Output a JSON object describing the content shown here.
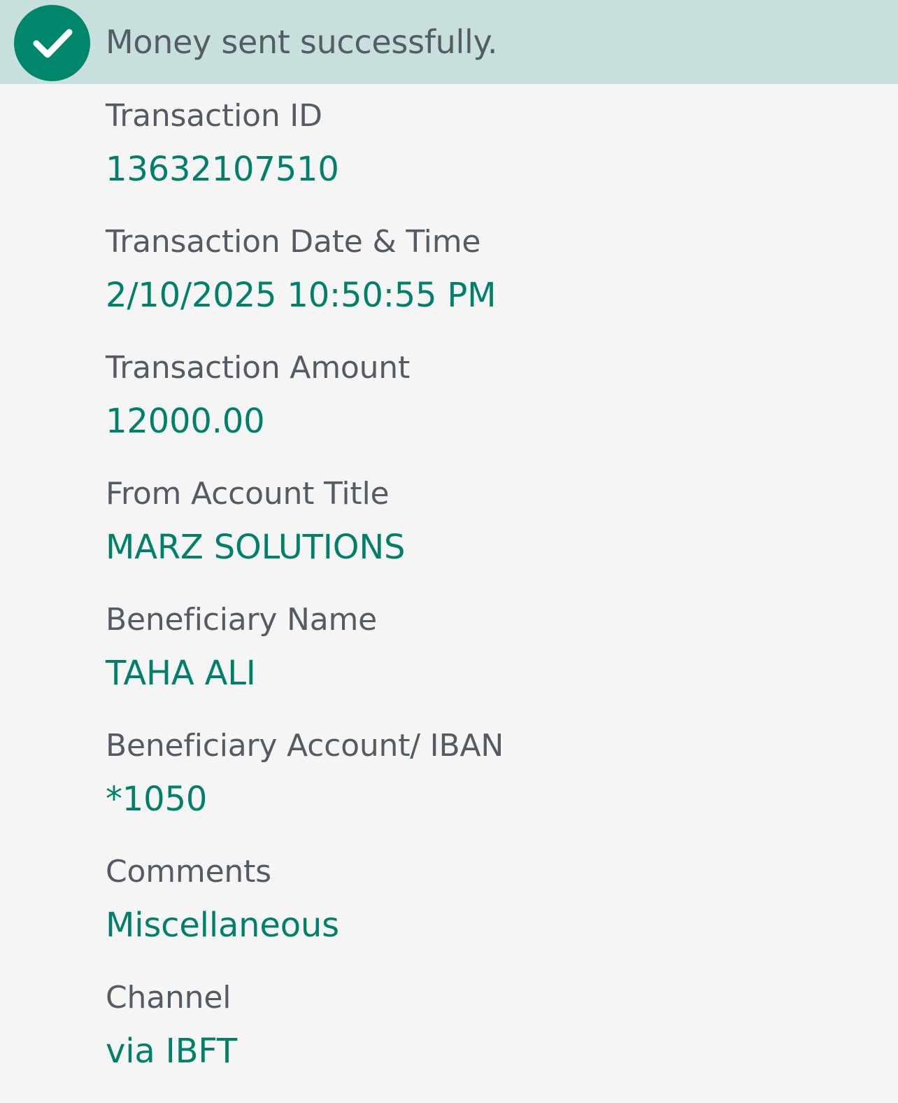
{
  "banner": {
    "icon": "check-circle-icon",
    "message": "Money sent successfully.",
    "background": "#c7dfdd",
    "icon_color": "#00866b"
  },
  "details": [
    {
      "label": "Transaction ID",
      "value": "13632107510"
    },
    {
      "label": "Transaction Date & Time",
      "value": "2/10/2025 10:50:55 PM"
    },
    {
      "label": "Transaction Amount",
      "value": "12000.00"
    },
    {
      "label": "From Account Title",
      "value": "MARZ SOLUTIONS"
    },
    {
      "label": "Beneficiary Name",
      "value": "TAHA ALI"
    },
    {
      "label": "Beneficiary Account/ IBAN",
      "value": "*1050"
    },
    {
      "label": "Comments",
      "value": "Miscellaneous"
    },
    {
      "label": "Channel",
      "value": "via IBFT"
    }
  ],
  "colors": {
    "page_background": "#f5f5f5",
    "label_text": "#545b62",
    "value_text": "#00806a"
  }
}
